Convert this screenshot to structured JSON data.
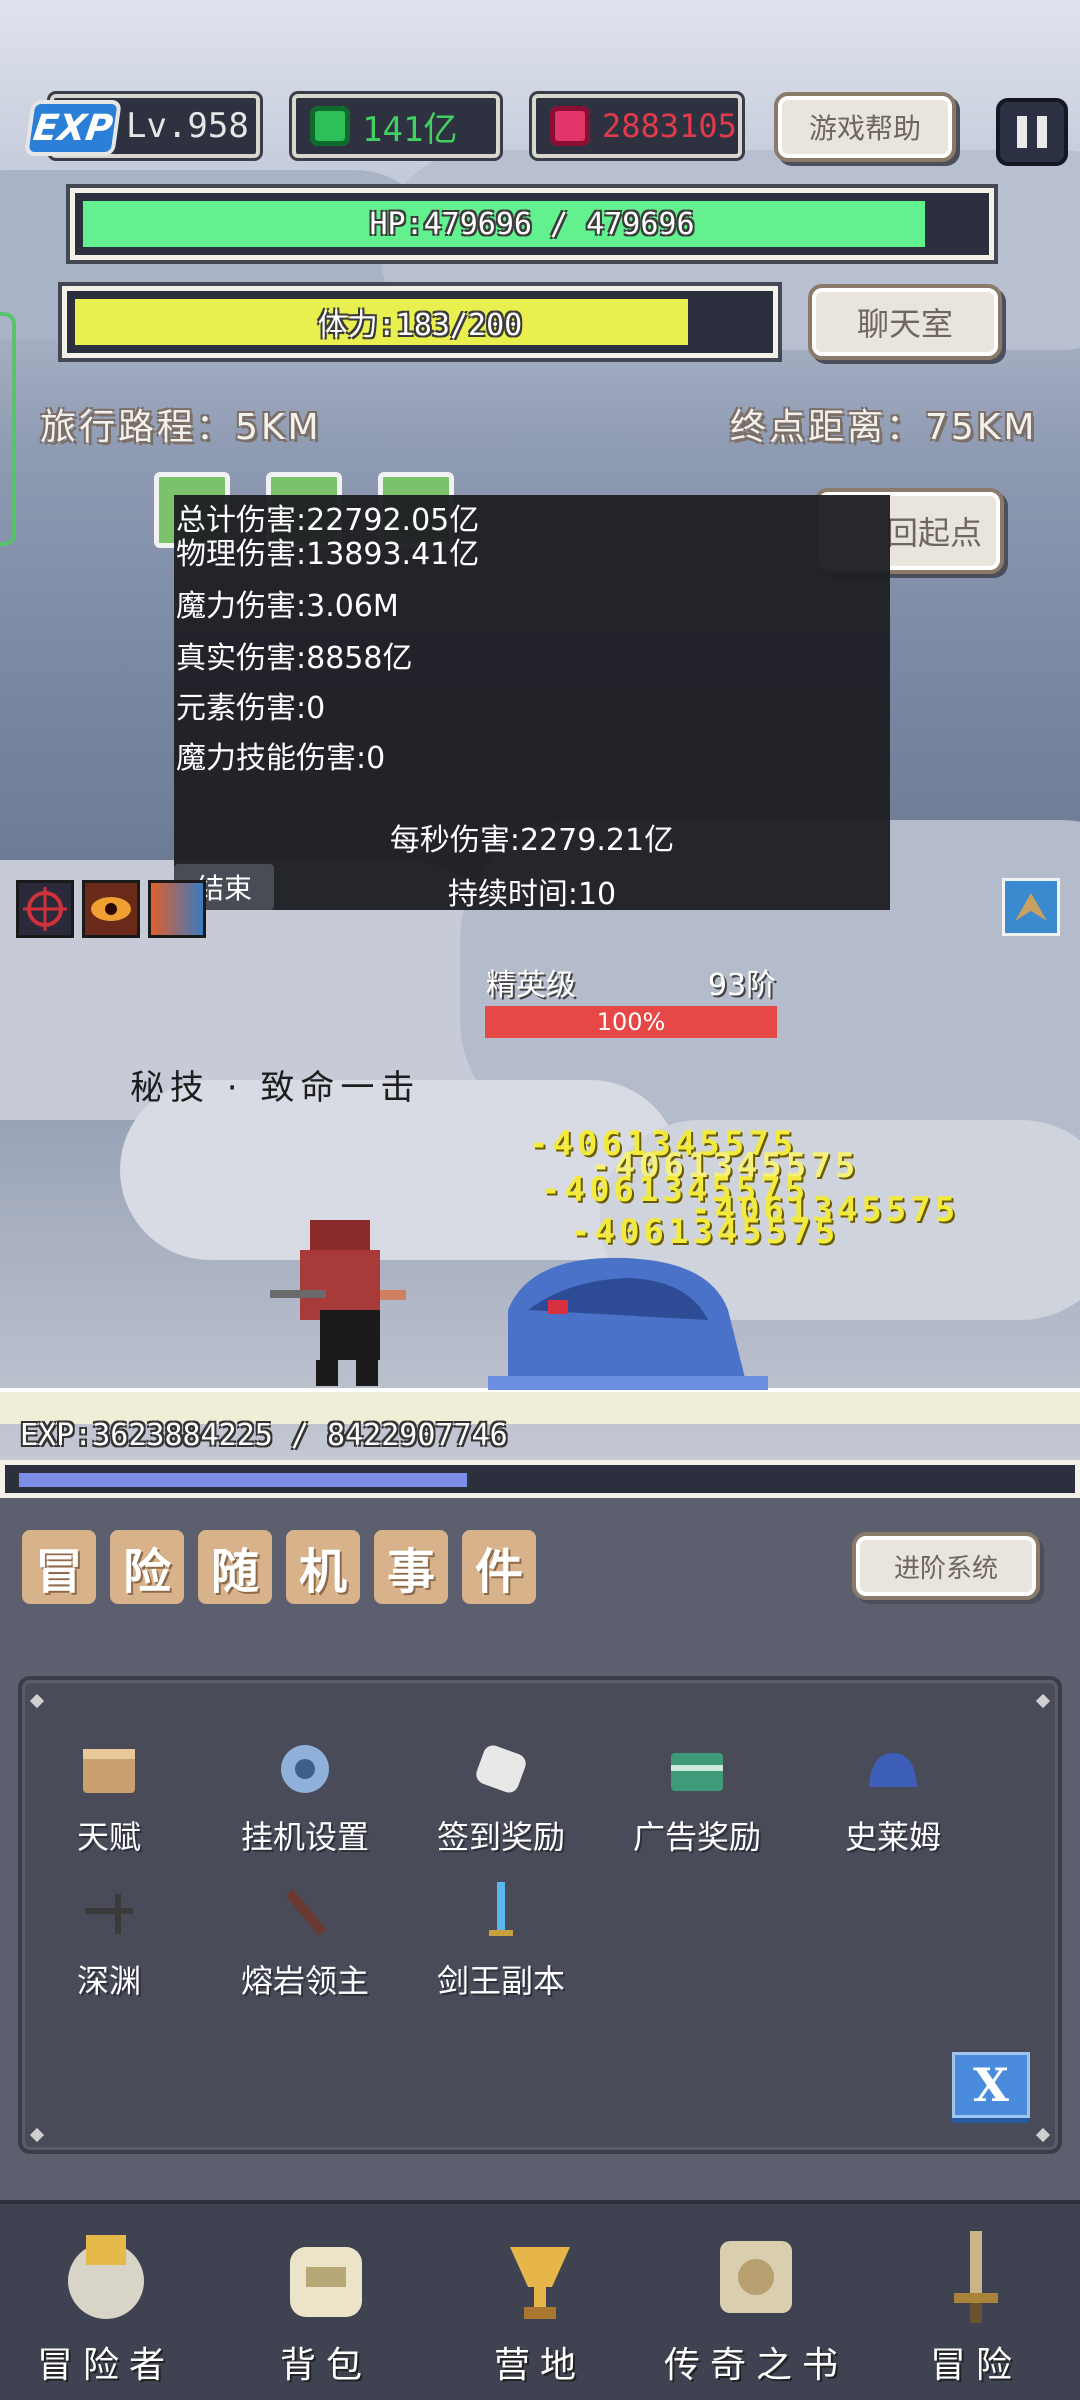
{
  "topbar": {
    "exp_badge": "EXP",
    "level": "Lv.958",
    "green_gems": "141亿",
    "red_gems": "2883105",
    "help_button": "游戏帮助"
  },
  "bars": {
    "hp_text": "HP:479696 / 479696",
    "hp_fraction": 1.0,
    "stamina_text": "体力:183/200",
    "stamina_fraction": 0.915,
    "chat_button": "聊天室"
  },
  "travel": {
    "distance": "旅行路程：5KM",
    "remaining": "终点距离：75KM",
    "back_button": "回起点"
  },
  "damage_panel": {
    "lines": [
      "总计伤害:22792.05亿",
      "物理伤害:13893.41亿",
      "魔力伤害:3.06M",
      "真实伤害:8858亿",
      "元素伤害:0",
      "魔力技能伤害:0"
    ],
    "dps": "每秒伤害:2279.21亿",
    "duration": "持续时间:10",
    "end_button": "结束"
  },
  "enemy": {
    "rank": "精英级",
    "tier": "93阶",
    "hp_percent": "100%",
    "hp_fraction": 1.0
  },
  "combat": {
    "skill_name": "秘技 · 致命一击",
    "damage_numbers": [
      "-4061345575",
      "-4061345575",
      "-4061345575",
      "-4061345575",
      "-4061345575"
    ]
  },
  "exp": {
    "text": "EXP:3623884225 / 8422907746",
    "fraction": 0.43
  },
  "events": {
    "title_chars": [
      "冒",
      "险",
      "随",
      "机",
      "事",
      "件"
    ],
    "advance_button": "进阶系统",
    "items": [
      {
        "label": "天赋",
        "icon": "book-icon"
      },
      {
        "label": "挂机设置",
        "icon": "gear-icon"
      },
      {
        "label": "签到奖励",
        "icon": "scroll-icon"
      },
      {
        "label": "广告奖励",
        "icon": "chest-icon"
      },
      {
        "label": "史莱姆",
        "icon": "slime-icon"
      },
      {
        "label": "深渊",
        "icon": "crossbow-icon"
      },
      {
        "label": "熔岩领主",
        "icon": "lava-sword-icon"
      },
      {
        "label": "剑王副本",
        "icon": "blue-sword-icon"
      }
    ],
    "close_button": "X"
  },
  "nav": [
    {
      "label": "冒险者",
      "icon": "knight-helmet-icon"
    },
    {
      "label": "背包",
      "icon": "backpack-icon"
    },
    {
      "label": "营地",
      "icon": "camp-trophy-icon"
    },
    {
      "label": "传奇之书",
      "icon": "legend-book-icon"
    },
    {
      "label": "冒险",
      "icon": "sword-icon"
    }
  ]
}
